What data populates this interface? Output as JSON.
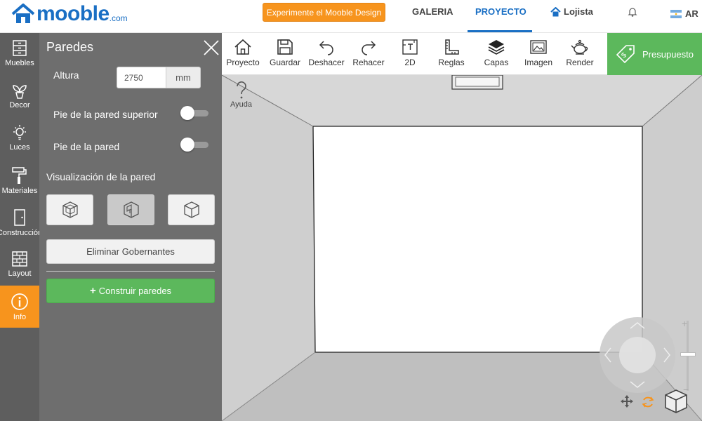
{
  "header": {
    "logo_text": "mooble",
    "logo_suffix": ".com",
    "promo_label": "Experimente el Mooble Design",
    "nav": {
      "galeria": "GALERIA",
      "proyecto": "PROYECTO",
      "lojista": "Lojista"
    },
    "lang": "AR"
  },
  "sidebar": {
    "items": [
      {
        "label": "Muebles",
        "icon": "dresser-icon"
      },
      {
        "label": "Decor",
        "icon": "plant-icon"
      },
      {
        "label": "Luces",
        "icon": "bulb-icon"
      },
      {
        "label": "Materiales",
        "icon": "paint-roller-icon"
      },
      {
        "label": "Construcción",
        "icon": "door-icon"
      },
      {
        "label": "Layout",
        "icon": "bricks-icon"
      },
      {
        "label": "Info",
        "icon": "info-icon"
      }
    ]
  },
  "panel": {
    "title": "Paredes",
    "altura_label": "Altura",
    "altura_value": "2750",
    "altura_unit": "mm",
    "pie_superior_label": "Pie de la pared superior",
    "pie_superior_on": false,
    "pie_pared_label": "Pie de la pared",
    "pie_pared_on": false,
    "visualizacion_label": "Visualización de la pared",
    "eliminar_label": "Eliminar Gobernantes",
    "construir_label": "Construir paredes"
  },
  "toolbar": {
    "proyecto": "Proyecto",
    "guardar": "Guardar",
    "deshacer": "Deshacer",
    "rehacer": "Rehacer",
    "d2": "2D",
    "reglas": "Reglas",
    "capas": "Capas",
    "imagen": "Imagen",
    "render": "Render",
    "presupuesto": "Presupuesto"
  },
  "viewport": {
    "ayuda_label": "Ayuda"
  },
  "colors": {
    "brand_blue": "#1a6fc4",
    "accent_orange": "#f7941d",
    "success_green": "#5cb85c",
    "sidebar_gray": "#5e5e5e",
    "panel_gray": "#6e6e6e"
  }
}
